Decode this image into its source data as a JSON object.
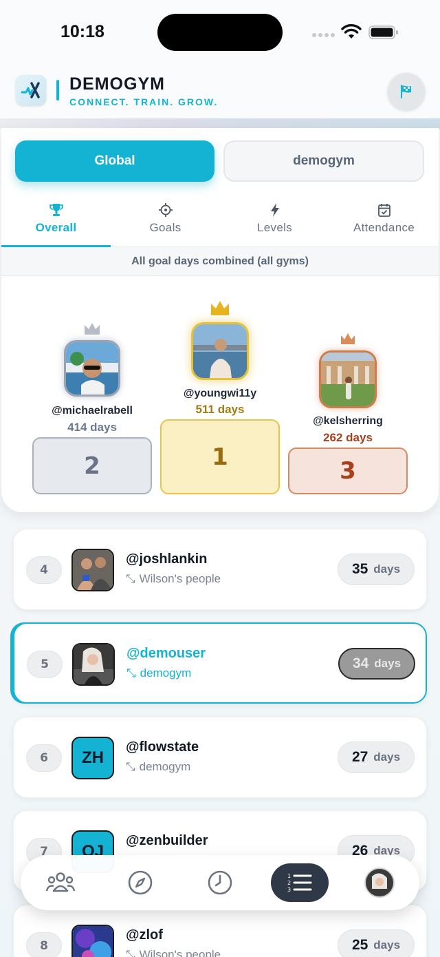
{
  "status": {
    "time": "10:18"
  },
  "header": {
    "brand": "DEMOGYM",
    "tagline": "CONNECT. TRAIN. GROW."
  },
  "scope": {
    "global_label": "Global",
    "gym_label": "demogym",
    "selected": "Global"
  },
  "tabs": [
    {
      "label": "Overall",
      "icon": "trophy-icon",
      "active": true
    },
    {
      "label": "Goals",
      "icon": "target-icon",
      "active": false
    },
    {
      "label": "Levels",
      "icon": "bolt-icon",
      "active": false
    },
    {
      "label": "Attendance",
      "icon": "calendar-check-icon",
      "active": false
    }
  ],
  "subtitle": "All goal days combined (all gyms)",
  "podium": {
    "first": {
      "handle": "@youngwi11y",
      "days": "511 days",
      "rank": "1"
    },
    "second": {
      "handle": "@michaelrabell",
      "days": "414 days",
      "rank": "2"
    },
    "third": {
      "handle": "@kelsherring",
      "days": "262 days",
      "rank": "3"
    }
  },
  "list": [
    {
      "rank": "4",
      "handle": "@joshlankin",
      "gym": "Wilson's people",
      "days": "35",
      "unit": "days"
    },
    {
      "rank": "5",
      "handle": "@demouser",
      "gym": "demogym",
      "days": "34",
      "unit": "days",
      "me": true
    },
    {
      "rank": "6",
      "handle": "@flowstate",
      "gym": "demogym",
      "days": "27",
      "unit": "days",
      "initials": "ZH"
    },
    {
      "rank": "7",
      "handle": "@zenbuilder",
      "gym": "",
      "days": "26",
      "unit": "days",
      "initials": "OJ"
    },
    {
      "rank": "8",
      "handle": "@zlof",
      "gym": "Wilson's people",
      "days": "25",
      "unit": "days"
    }
  ],
  "colors": {
    "accent": "#14b3d4",
    "gold": "#e6c23a",
    "silver": "#9aa3b2",
    "bronze": "#cf7a4a"
  },
  "bottom_nav": [
    "people-icon",
    "compass-icon",
    "clock-icon",
    "leaderboard-icon",
    "profile-avatar"
  ]
}
